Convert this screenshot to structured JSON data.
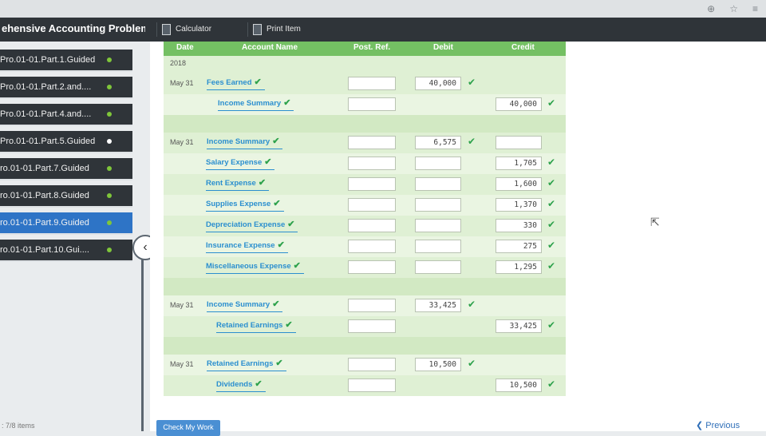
{
  "header": {
    "title": "ehensive Accounting Problem",
    "tools": [
      {
        "label": "Calculator"
      },
      {
        "label": "Print Item"
      }
    ]
  },
  "sidebar": {
    "items": [
      {
        "label": "Pro.01-01.Part.1.Guided",
        "active": false
      },
      {
        "label": "Pro.01-01.Part.2.and....",
        "active": false
      },
      {
        "label": "Pro.01-01.Part.4.and....",
        "active": false
      },
      {
        "label": "Pro.01-01.Part.5.Guided",
        "active": false
      },
      {
        "label": "ro.01-01.Part.7.Guided",
        "active": false
      },
      {
        "label": "ro.01-01.Part.8.Guided",
        "active": false
      },
      {
        "label": "ro.01-01.Part.9.Guided",
        "active": true
      },
      {
        "label": "ro.01-01.Part.10.Gui....",
        "active": false
      }
    ],
    "count_text": ": 7/8 items"
  },
  "journal": {
    "columns": {
      "date": "Date",
      "account": "Account Name",
      "post_ref": "Post. Ref.",
      "debit": "Debit",
      "credit": "Credit"
    },
    "year": "2018",
    "entries": [
      {
        "date": "May 31",
        "account": "Fees Earned",
        "debit": "40,000",
        "credit": ""
      },
      {
        "date": "",
        "account": "Income Summary",
        "debit": "",
        "credit": "40,000"
      },
      {
        "date": "May 31",
        "account": "Income Summary",
        "debit": "6,575",
        "credit": ""
      },
      {
        "date": "",
        "account": "Salary Expense",
        "debit": "",
        "credit": "1,705"
      },
      {
        "date": "",
        "account": "Rent Expense",
        "debit": "",
        "credit": "1,600"
      },
      {
        "date": "",
        "account": "Supplies Expense",
        "debit": "",
        "credit": "1,370"
      },
      {
        "date": "",
        "account": "Depreciation Expense",
        "debit": "",
        "credit": "330"
      },
      {
        "date": "",
        "account": "Insurance Expense",
        "debit": "",
        "credit": "275"
      },
      {
        "date": "",
        "account": "Miscellaneous Expense",
        "debit": "",
        "credit": "1,295"
      },
      {
        "date": "May 31",
        "account": "Income Summary",
        "debit": "33,425",
        "credit": ""
      },
      {
        "date": "",
        "account": "Retained Earnings",
        "debit": "",
        "credit": "33,425"
      },
      {
        "date": "May 31",
        "account": "Retained Earnings",
        "debit": "10,500",
        "credit": ""
      },
      {
        "date": "",
        "account": "Dividends",
        "debit": "",
        "credit": "10,500"
      }
    ]
  },
  "footer": {
    "check_work": "Check My Work",
    "previous": "Previous"
  },
  "colors": {
    "header_green": "#74c063",
    "link_blue": "#2b8fcf",
    "check_green": "#2ea24c",
    "active_nav": "#2e74c6"
  }
}
